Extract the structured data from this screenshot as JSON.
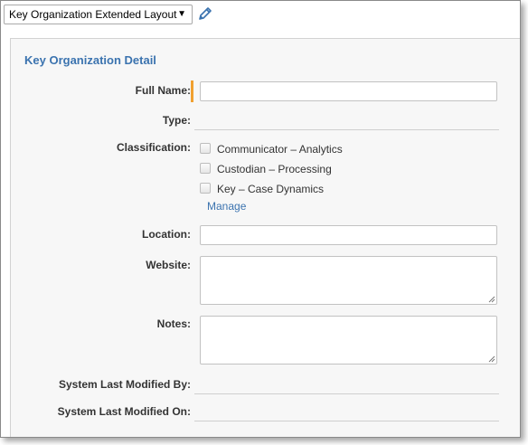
{
  "layout_selector": {
    "value": "Key Organization Extended Layout",
    "arrow": "▼"
  },
  "icons": {
    "edit": "pencil-icon",
    "dropdown": "caret-down-icon"
  },
  "colors": {
    "accent": "#3b73af",
    "required": "#f0a030"
  },
  "section": {
    "title": "Key Organization Detail",
    "fields": {
      "full_name": {
        "label": "Full Name:",
        "value": "",
        "required": true
      },
      "type": {
        "label": "Type:",
        "value": ""
      },
      "classification": {
        "label": "Classification:",
        "options": [
          {
            "text": "Communicator – Analytics",
            "checked": false
          },
          {
            "text": "Custodian – Processing",
            "checked": false
          },
          {
            "text": "Key –  Case Dynamics",
            "checked": false
          }
        ],
        "manage_label": "Manage"
      },
      "location": {
        "label": "Location:",
        "value": ""
      },
      "website": {
        "label": "Website:",
        "value": ""
      },
      "notes": {
        "label": "Notes:",
        "value": ""
      },
      "modified_by": {
        "label": "System Last Modified By:",
        "value": ""
      },
      "modified_on": {
        "label": "System Last Modified On:",
        "value": ""
      }
    }
  }
}
